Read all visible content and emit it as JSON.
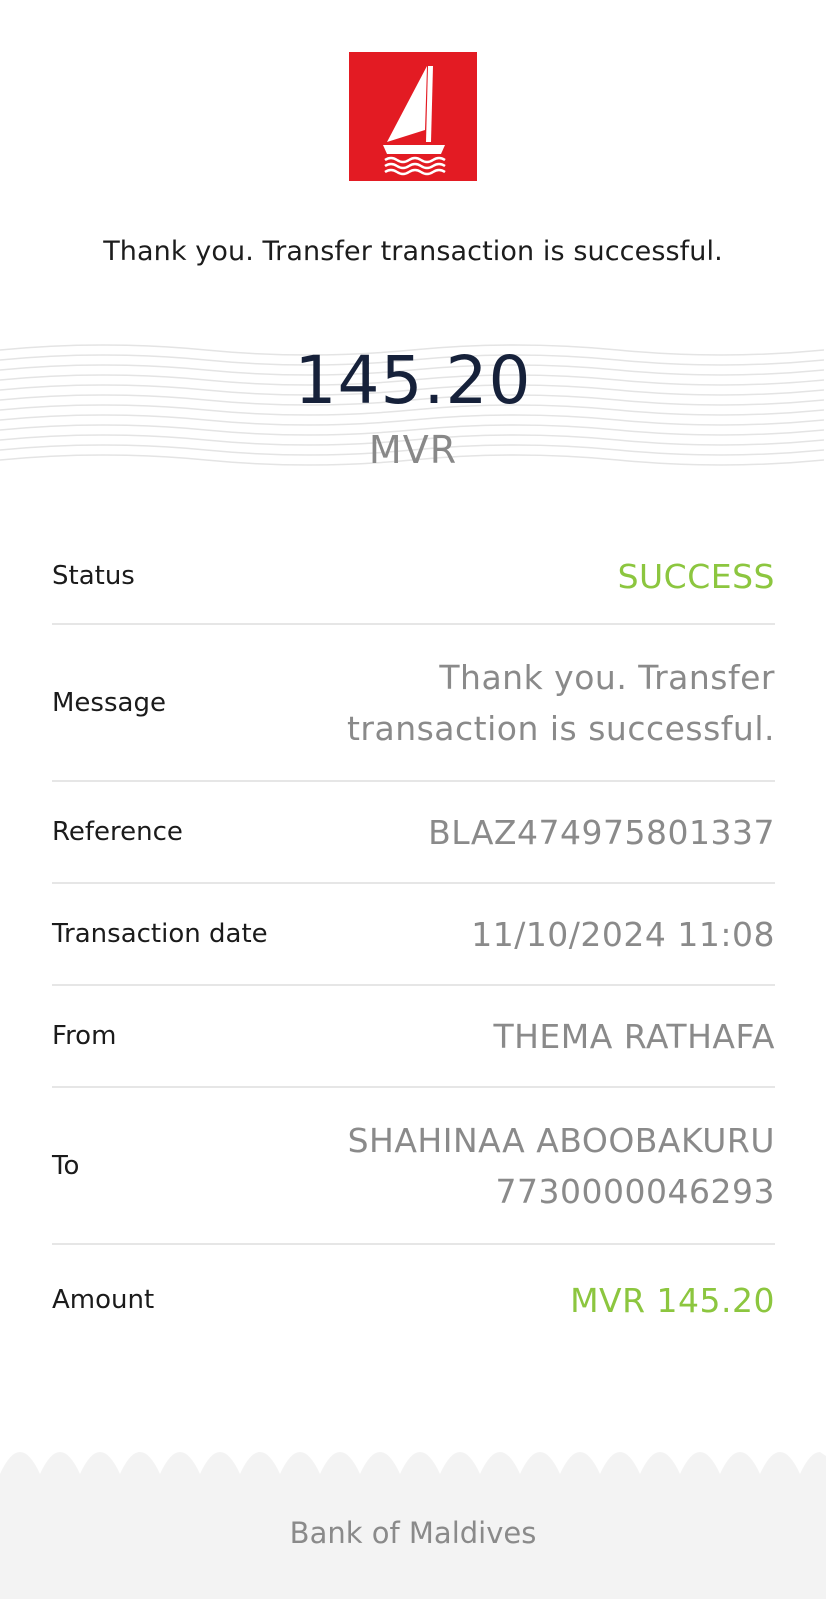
{
  "header": {
    "logo": "bank-sailboat-logo",
    "message": "Thank you. Transfer transaction is successful."
  },
  "summary": {
    "amount": "145.20",
    "currency": "MVR"
  },
  "details": {
    "status_label": "Status",
    "status_value": "SUCCESS",
    "message_label": "Message",
    "message_line1": "Thank you. Transfer",
    "message_line2": "transaction is successful.",
    "reference_label": "Reference",
    "reference_value": "BLAZ474975801337",
    "date_label": "Transaction date",
    "date_value": "11/10/2024 11:08",
    "from_label": "From",
    "from_value": "THEMA RATHAFA",
    "to_label": "To",
    "to_name": "SHAHINAA ABOOBAKURU",
    "to_account": "7730000046293",
    "amount_label": "Amount",
    "amount_value": "MVR 145.20"
  },
  "footer": {
    "text": "Bank of Maldives"
  },
  "colors": {
    "brand_red": "#e31b23",
    "success_green": "#8cc63f",
    "amount_navy": "#16213a"
  }
}
